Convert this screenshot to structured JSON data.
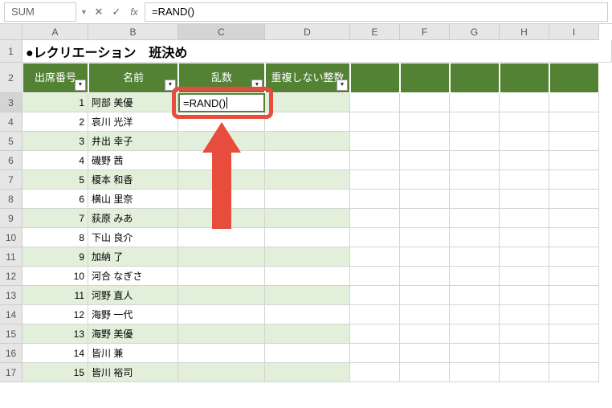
{
  "nameBox": "SUM",
  "formulaBar": "=RAND()",
  "title": "●レクリエーション　班決め",
  "columns": [
    "A",
    "B",
    "C",
    "D",
    "E",
    "F",
    "G",
    "H",
    "I"
  ],
  "headers": {
    "a": "出席番号",
    "b": "名前",
    "c": "乱数",
    "d": "重複しない整数"
  },
  "activeCell": {
    "value": "=RAND()"
  },
  "rows": [
    {
      "num": "1",
      "name": "阿部 美優"
    },
    {
      "num": "2",
      "name": "哀川 光洋"
    },
    {
      "num": "3",
      "name": "井出 幸子"
    },
    {
      "num": "4",
      "name": "磯野 茜"
    },
    {
      "num": "5",
      "name": "榎本 和香"
    },
    {
      "num": "6",
      "name": "横山 里奈"
    },
    {
      "num": "7",
      "name": "荻原 みあ"
    },
    {
      "num": "8",
      "name": "下山 良介"
    },
    {
      "num": "9",
      "name": "加納 了"
    },
    {
      "num": "10",
      "name": "河合 なぎさ"
    },
    {
      "num": "11",
      "name": "河野 直人"
    },
    {
      "num": "12",
      "name": "海野 一代"
    },
    {
      "num": "13",
      "name": "海野 美優"
    },
    {
      "num": "14",
      "name": "皆川 兼"
    },
    {
      "num": "15",
      "name": "皆川 裕司"
    }
  ],
  "rowNumbers": [
    "1",
    "2",
    "3",
    "4",
    "5",
    "6",
    "7",
    "8",
    "9",
    "10",
    "11",
    "12",
    "13",
    "14",
    "15",
    "16",
    "17"
  ]
}
